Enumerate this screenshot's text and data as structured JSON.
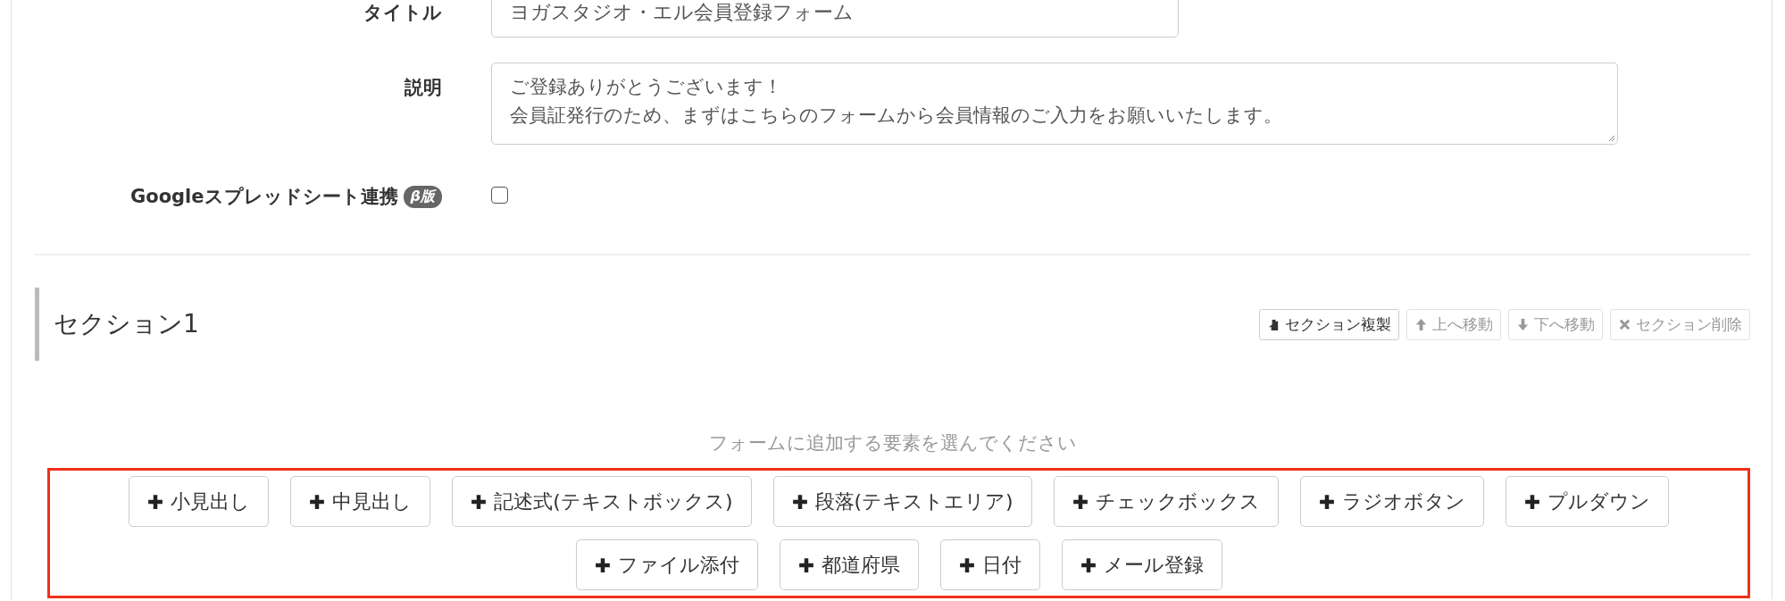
{
  "form_settings": [
    {
      "kind": "text",
      "label": "タイトル",
      "value": "ヨガスタジオ・エル会員登録フォーム"
    },
    {
      "kind": "textarea",
      "label": "説明",
      "lines": [
        "ご登録ありがとうございます！",
        "会員証発行のため、まずはこちらのフォームから会員情報のご入力をお願いいたします。"
      ]
    },
    {
      "kind": "checkbox",
      "label": "Googleスプレッドシート連携",
      "badge": "β版",
      "checked": false
    }
  ],
  "section": {
    "title": "セクション1",
    "actions": [
      {
        "kind": "copy",
        "label": "セクション複製",
        "disabled": false
      },
      {
        "kind": "up",
        "label": "上へ移動",
        "disabled": true
      },
      {
        "kind": "down",
        "label": "下へ移動",
        "disabled": true
      },
      {
        "kind": "delete",
        "label": "セクション削除",
        "disabled": true
      }
    ]
  },
  "add_elements": {
    "hint": "フォームに追加する要素を選んでください",
    "buttons": [
      "小見出し",
      "中見出し",
      "記述式(テキストボックス)",
      "段落(テキストエリア)",
      "チェックボックス",
      "ラジオボタン",
      "プルダウン",
      "ファイル添付",
      "都道府県",
      "日付",
      "メール登録"
    ]
  }
}
